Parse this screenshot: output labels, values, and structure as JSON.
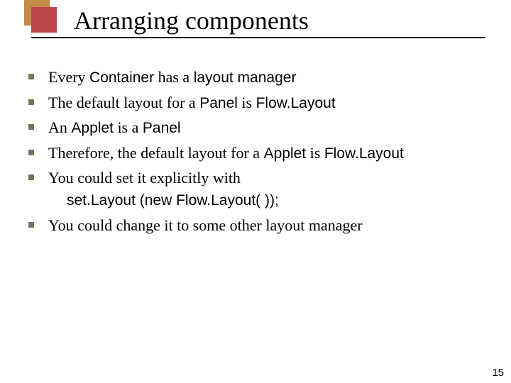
{
  "title": "Arranging components",
  "bullets": {
    "b1": {
      "t1": "Every ",
      "s1": "Container",
      "t2": " has a ",
      "s2": "layout manager"
    },
    "b2": {
      "t1": "The default layout for a ",
      "s1": "Panel",
      "t2": " is ",
      "s2": "Flow.Layout"
    },
    "b3": {
      "t1": "An ",
      "s1": "Applet",
      "t2": " is a ",
      "s2": "Panel"
    },
    "b4": {
      "t1": "Therefore, the default layout for a ",
      "s1": "Applet",
      "t2": " is ",
      "s2": "Flow.Layout"
    },
    "b5": {
      "t1": "You could set it explicitly with",
      "code": "set.Layout (new Flow.Layout( ));"
    },
    "b6": {
      "t1": "You could change it to some other layout manager"
    }
  },
  "page_number": "15"
}
